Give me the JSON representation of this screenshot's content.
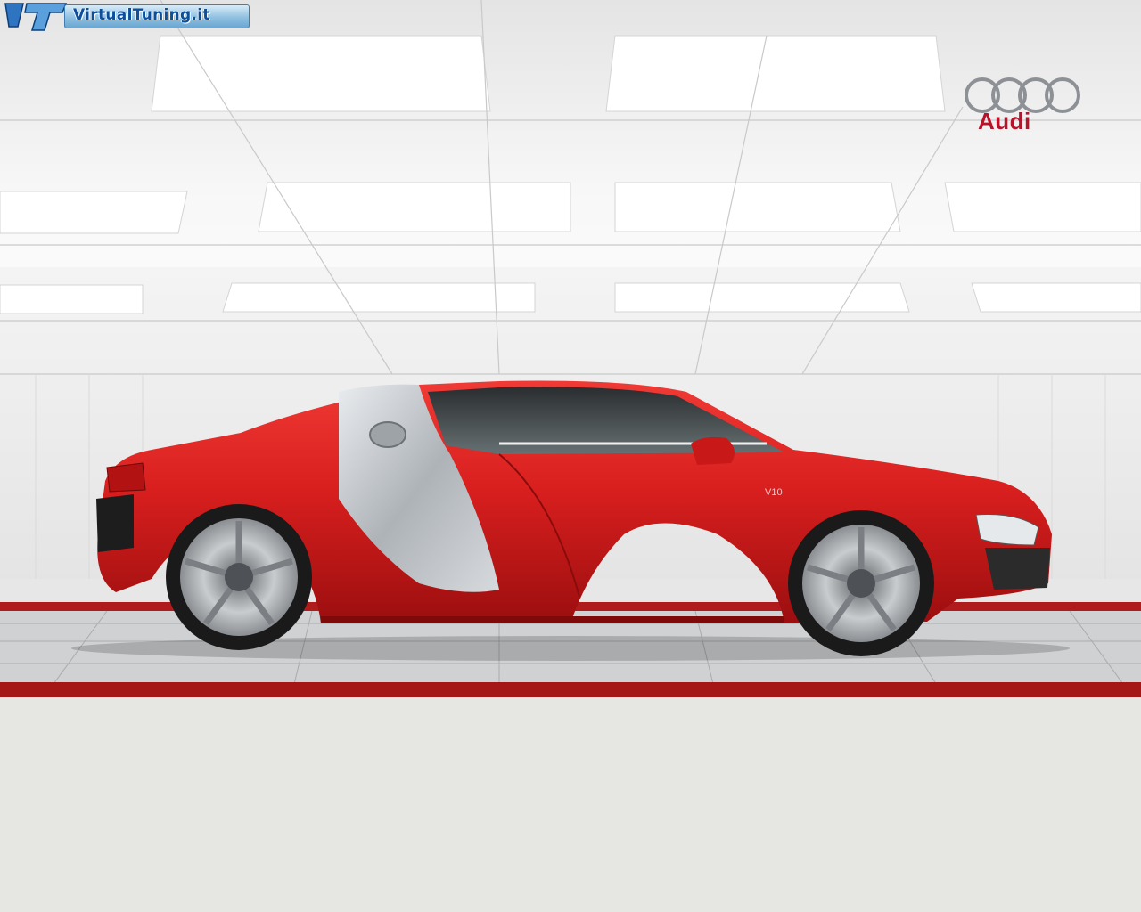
{
  "watermark": {
    "site_text": "VirtualTuning.it"
  },
  "brand": {
    "wordmark": "Audi",
    "color": "#b8132b"
  },
  "vehicle": {
    "badge_text": "V10",
    "body_color": "#d01f1f",
    "blade_color": "#b9bdc2"
  },
  "colors": {
    "studio_background": "#ededed",
    "floor_stripe": "#b01c1c",
    "lower_area": "#e6e6e2"
  }
}
